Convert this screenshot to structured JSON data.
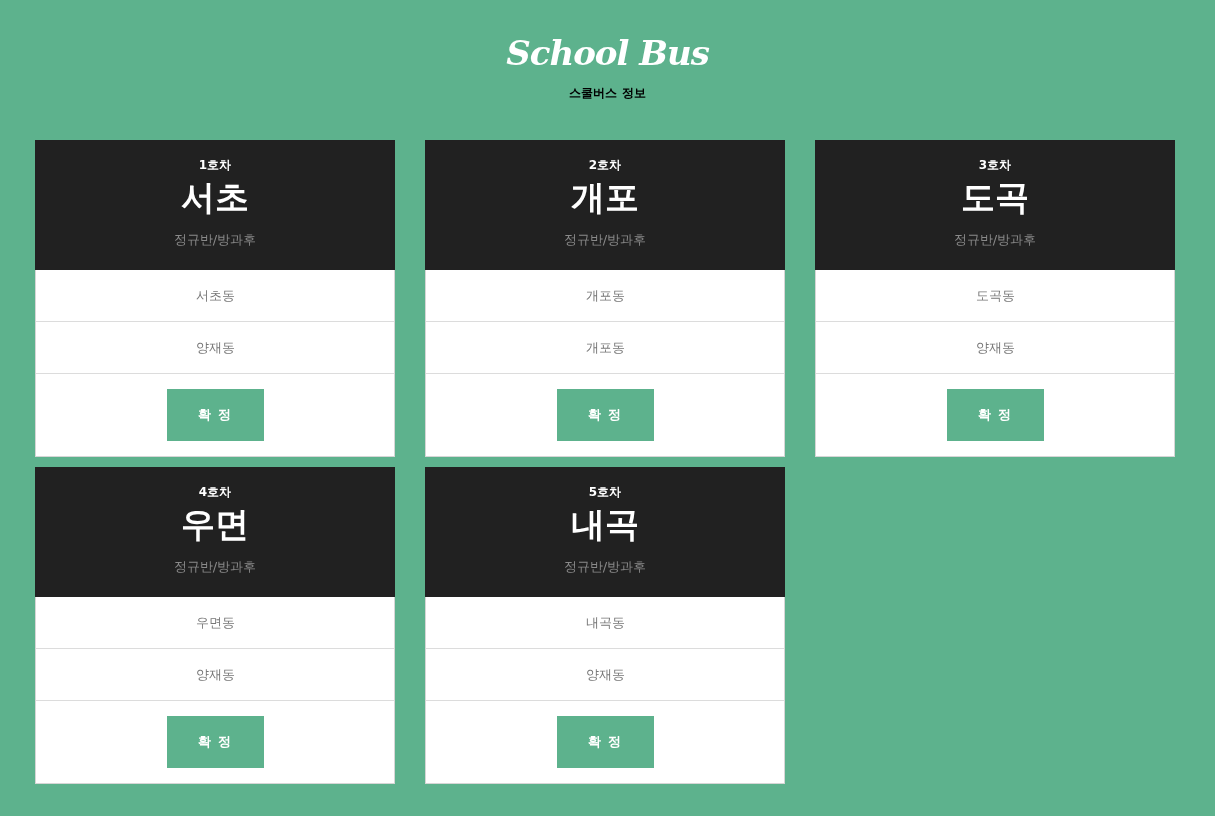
{
  "header": {
    "title": "School Bus",
    "subtitle": "스쿨버스 정보"
  },
  "buses": [
    {
      "number": "1호차",
      "area": "서초",
      "type": "정규반/방과후",
      "stops": [
        "서초동",
        "양재동"
      ],
      "button": "확 정"
    },
    {
      "number": "2호차",
      "area": "개포",
      "type": "정규반/방과후",
      "stops": [
        "개포동",
        "개포동"
      ],
      "button": "확 정"
    },
    {
      "number": "3호차",
      "area": "도곡",
      "type": "정규반/방과후",
      "stops": [
        "도곡동",
        "양재동"
      ],
      "button": "확 정"
    },
    {
      "number": "4호차",
      "area": "우면",
      "type": "정규반/방과후",
      "stops": [
        "우면동",
        "양재동"
      ],
      "button": "확 정"
    },
    {
      "number": "5호차",
      "area": "내곡",
      "type": "정규반/방과후",
      "stops": [
        "내곡동",
        "양재동"
      ],
      "button": "확 정"
    }
  ]
}
